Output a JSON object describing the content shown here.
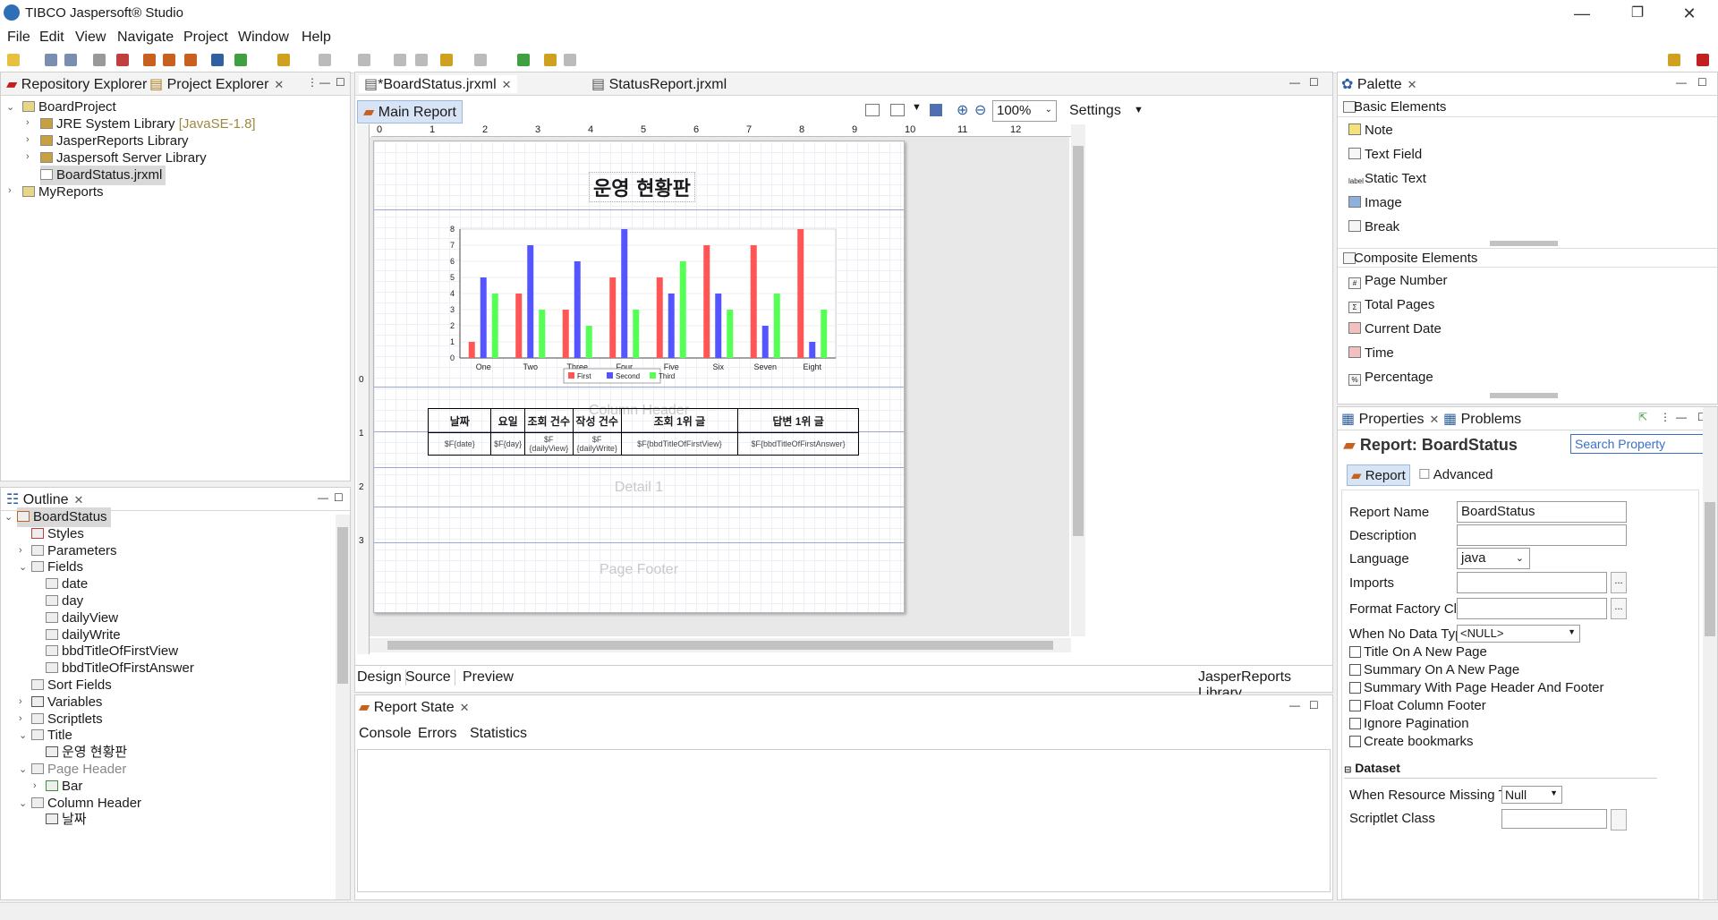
{
  "window": {
    "title": "TIBCO Jaspersoft® Studio",
    "controls": [
      "—",
      "❐",
      "✕"
    ]
  },
  "menu": [
    "File",
    "Edit",
    "View",
    "Navigate",
    "Project",
    "Window",
    "Help"
  ],
  "left_top": {
    "tabs": [
      "Repository Explorer",
      "Project Explorer"
    ],
    "tree": [
      {
        "label": "BoardProject",
        "level": 0,
        "icon": "project-folder-icon"
      },
      {
        "label": "JRE System Library",
        "extra": "[JavaSE-1.8]",
        "level": 1,
        "icon": "library-icon"
      },
      {
        "label": "JasperReports Library",
        "level": 1,
        "icon": "library-icon"
      },
      {
        "label": "Jaspersoft Server Library",
        "level": 1,
        "icon": "library-icon"
      },
      {
        "label": "BoardStatus.jrxml",
        "level": 1,
        "icon": "report-file-icon"
      },
      {
        "label": "MyReports",
        "level": 0,
        "icon": "project-folder-icon"
      }
    ]
  },
  "outline": {
    "tab": "Outline",
    "tree": [
      {
        "label": "BoardStatus",
        "level": 0
      },
      {
        "label": "Styles",
        "level": 1
      },
      {
        "label": "Parameters",
        "level": 1
      },
      {
        "label": "Fields",
        "level": 1
      },
      {
        "label": "date",
        "level": 2
      },
      {
        "label": "day",
        "level": 2
      },
      {
        "label": "dailyView",
        "level": 2
      },
      {
        "label": "dailyWrite",
        "level": 2
      },
      {
        "label": "bbdTitleOfFirstView",
        "level": 2
      },
      {
        "label": "bbdTitleOfFirstAnswer",
        "level": 2
      },
      {
        "label": "Sort Fields",
        "level": 1
      },
      {
        "label": "Variables",
        "level": 1
      },
      {
        "label": "Scriptlets",
        "level": 1
      },
      {
        "label": "Title",
        "level": 1
      },
      {
        "label": "운영 현황판",
        "level": 2
      },
      {
        "label": "Page Header",
        "level": 1
      },
      {
        "label": "Bar",
        "level": 2
      },
      {
        "label": "Column Header",
        "level": 1
      },
      {
        "label": "날짜",
        "level": 2
      }
    ]
  },
  "editor": {
    "tabs": [
      "*BoardStatus.jrxml",
      "StatusReport.jrxml"
    ],
    "subtab": "Main Report",
    "zoom": "100%",
    "settings_label": "Settings",
    "ruler_numbers": [
      "0",
      "1",
      "2",
      "3",
      "4",
      "5",
      "6",
      "7",
      "8",
      "9",
      "10",
      "11",
      "12"
    ],
    "vruler_numbers": [
      "0",
      "1",
      "2",
      "3"
    ],
    "bottom_tabs": [
      "Design",
      "Source",
      "Preview"
    ],
    "library_label": "JasperReports Library",
    "report": {
      "title": "운영 현황판",
      "band_labels": [
        "Page Header",
        "Column Header",
        "Detail 1",
        "Page Footer"
      ],
      "table_headers": [
        "날짜",
        "요일",
        "조회 건수",
        "작성 건수",
        "조회 1위 글",
        "답변 1위 글"
      ],
      "table_cells": [
        "$F{date}",
        "$F{day}",
        "$F {dailyView}",
        "$F {dailyWrite}",
        "$F{bbdTitleOfFirstView}",
        "$F{bbdTitleOfFirstAnswer}"
      ]
    }
  },
  "chart_data": {
    "type": "bar",
    "categories": [
      "One",
      "Two",
      "Three",
      "Four",
      "Five",
      "Six",
      "Seven",
      "Eight"
    ],
    "series": [
      {
        "name": "First",
        "color": "#ff5555",
        "values": [
          1,
          4,
          3,
          5,
          5,
          7,
          7,
          8
        ]
      },
      {
        "name": "Second",
        "color": "#5555ff",
        "values": [
          5,
          7,
          6,
          8,
          4,
          4,
          2,
          1
        ]
      },
      {
        "name": "Third",
        "color": "#55ff55",
        "values": [
          4,
          3,
          2,
          3,
          6,
          3,
          4,
          3
        ]
      }
    ],
    "yticks": [
      "0",
      "1",
      "2",
      "3",
      "4",
      "5",
      "6",
      "7",
      "8"
    ],
    "ylim": [
      0,
      8
    ],
    "legend": "bottom"
  },
  "report_state": {
    "tab": "Report State",
    "subtabs": [
      "Console",
      "Errors",
      "Statistics"
    ]
  },
  "palette": {
    "tab": "Palette",
    "basic_header": "Basic Elements",
    "basic": [
      "Note",
      "Text Field",
      "Static Text",
      "Image",
      "Break"
    ],
    "composite_header": "Composite Elements",
    "composite": [
      "Page Number",
      "Total Pages",
      "Current Date",
      "Time",
      "Percentage"
    ]
  },
  "properties": {
    "tabs": [
      "Properties",
      "Problems"
    ],
    "heading": "Report: BoardStatus",
    "search_placeholder": "Search Property",
    "subtabs": [
      "Report",
      "Advanced"
    ],
    "report_name_label": "Report Name",
    "report_name_value": "BoardStatus",
    "description_label": "Description",
    "language_label": "Language",
    "language_value": "java",
    "imports_label": "Imports",
    "format_factory_label": "Format Factory Class",
    "no_data_label": "When No Data Type",
    "no_data_value": "<NULL>",
    "checkboxes": [
      "Title On A New Page",
      "Summary On A New Page",
      "Summary With Page Header And Footer",
      "Float Column Footer",
      "Ignore Pagination",
      "Create bookmarks"
    ],
    "dataset_header": "Dataset",
    "missing_type_label": "When Resource Missing Type",
    "missing_type_value": "Null",
    "scriptlet_label": "Scriptlet Class"
  }
}
